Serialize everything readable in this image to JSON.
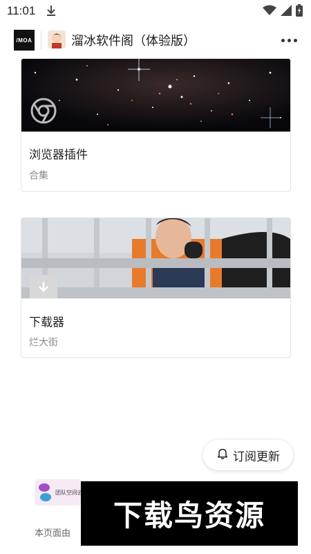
{
  "status": {
    "time": "11:01"
  },
  "appbar": {
    "title": "溜冰软件阁（体验版）",
    "logo_text": "/MOA"
  },
  "cards": [
    {
      "name": "浏览器插件",
      "sub": "合集",
      "icon": "chrome-icon"
    },
    {
      "name": "下载器",
      "sub": "烂大街",
      "icon": "download-icon"
    }
  ],
  "subscribe": {
    "label": "订阅更新"
  },
  "footer": {
    "logo_text": "团队空间云",
    "text": "本页面由"
  },
  "watermark": {
    "text": "下载鸟资源"
  },
  "colors": {
    "accent": "#222222",
    "muted": "#8a8a8a",
    "border": "#e4e4e4"
  }
}
